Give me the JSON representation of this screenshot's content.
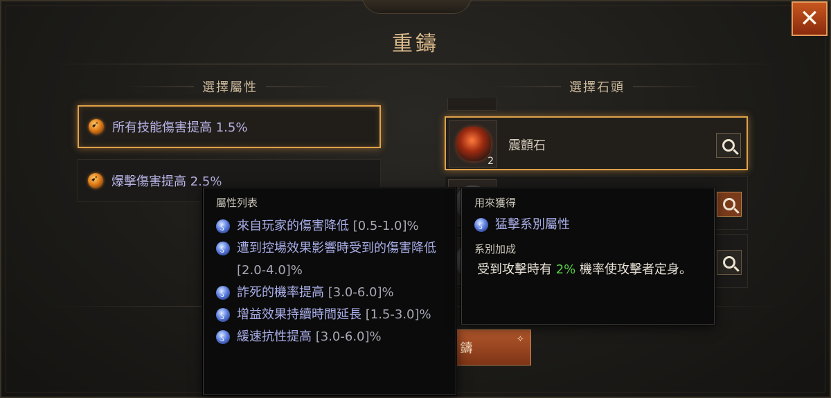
{
  "dialog": {
    "title": "重鑄",
    "close_label": "✕"
  },
  "attributes": {
    "heading": "選擇屬性",
    "items": [
      {
        "label": "所有技能傷害提高 1.5%",
        "selected": true
      },
      {
        "label": "爆擊傷害提高 2.5%",
        "selected": false
      }
    ]
  },
  "stones": {
    "heading": "選擇石頭",
    "items": [
      {
        "name": "震顫石",
        "count": "2",
        "selected": true
      },
      {
        "name": "",
        "count": "",
        "selected": false
      },
      {
        "name": "",
        "count": "",
        "selected": false
      }
    ]
  },
  "reforge_button": {
    "label": "重鑄"
  },
  "attribute_tooltip": {
    "heading": "屬性列表",
    "items": [
      {
        "text": "來自玩家的傷害降低",
        "range": "[0.5-1.0]%"
      },
      {
        "text": "遭到控場效果影響時受到的傷害降低",
        "range": "[2.0-4.0]%"
      },
      {
        "text": "詐死的機率提高",
        "range": "[3.0-6.0]%"
      },
      {
        "text": "增益效果持續時間延長",
        "range": "[1.5-3.0]%"
      },
      {
        "text": "緩速抗性提高",
        "range": "[3.0-6.0]%"
      }
    ]
  },
  "stone_tooltip": {
    "obtain_heading": "用來獲得",
    "obtain_item": "猛擊系別屬性",
    "bonus_heading": "系別加成",
    "bonus_prefix": "受到攻擊時有",
    "bonus_value": "2%",
    "bonus_suffix": "機率使攻擊者定身。"
  },
  "colors": {
    "accent_orange": "#e0a24a",
    "attr_text": "#b8b3e6",
    "tooltip_rune_blue": "#5c7fe0",
    "highlight_green": "#5cd04a",
    "close_button": "#c7561f"
  },
  "icons": {
    "close": "close-icon",
    "attribute_orb": "flame-orb-icon",
    "tooltip_rune": "blue-rune-icon",
    "inspect": "magnifier-icon"
  }
}
